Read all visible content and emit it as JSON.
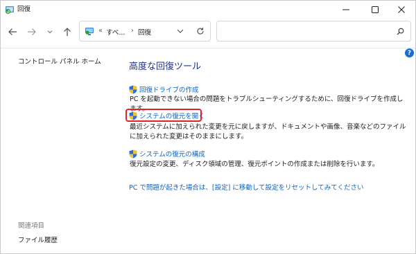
{
  "window": {
    "title": "回復"
  },
  "address": {
    "overflow": "«",
    "crumb_all": "すべ...",
    "separator": "›",
    "crumb_current": "回復"
  },
  "search": {
    "placeholder": ""
  },
  "left_pane": {
    "home_link": "コントロール パネル ホーム",
    "related_heading": "関連項目",
    "file_history": "ファイル履歴"
  },
  "main": {
    "title": "高度な回復ツール",
    "tools": [
      {
        "label": "回復ドライブの作成",
        "desc": "PC を起動できない場合の問題をトラブルシューティングするために、回復ドライブを作成します。"
      },
      {
        "label": "システムの復元を開く",
        "desc": "最近システムに加えられた変更を元に戻しますが、ドキュメントや画像、音楽などのファイルに加えられた変更はそのままにします。"
      },
      {
        "label": "システムの復元の構成",
        "desc": "復元設定の変更、ディスク領域の管理、復元ポイントの作成または削除を行います。"
      }
    ],
    "reset_link": "PC で問題が起きた場合は、[設定] に移動して設定をリセットしてみてください",
    "help_label": "?"
  },
  "colors": {
    "link": "#0b63c5",
    "title": "#1e3287",
    "highlight": "#e52222",
    "help": "#1a6fd1"
  }
}
